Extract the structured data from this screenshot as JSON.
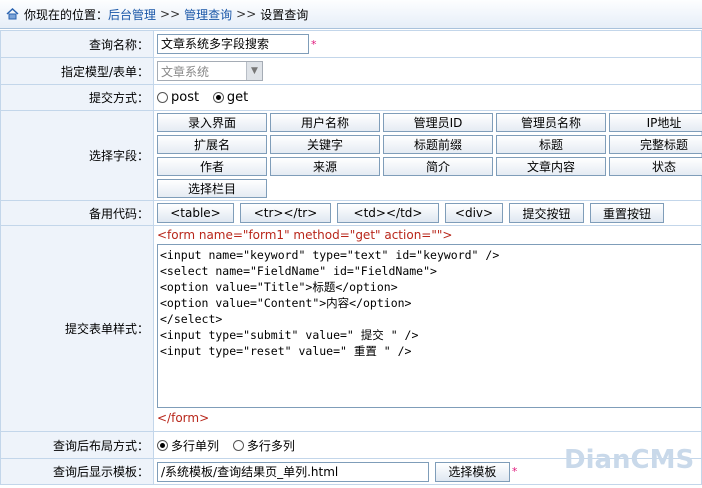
{
  "breadcrumb": {
    "prefix": "你现在的位置：",
    "items": [
      "后台管理",
      "管理查询",
      "设置查询"
    ],
    "separator": ">>"
  },
  "form": {
    "query_name": {
      "label": "查询名称：",
      "value": "文章系统多字段搜索"
    },
    "model": {
      "label": "指定模型/表单：",
      "selected": "文章系统"
    },
    "method": {
      "label": "提交方式：",
      "options": [
        "post",
        "get"
      ],
      "selected": "get"
    },
    "fields": {
      "label": "选择字段：",
      "items": [
        "录入界面",
        "用户名称",
        "管理员ID",
        "管理员名称",
        "IP地址",
        "扩展名",
        "关键字",
        "标题前缀",
        "标题",
        "完整标题",
        "作者",
        "来源",
        "简介",
        "文章内容",
        "状态",
        "选择栏目"
      ]
    },
    "code": {
      "label": "备用代码：",
      "buttons": [
        "<table>",
        "<tr></tr>",
        "<td></td>",
        "<div>",
        "提交按钮",
        "重置按钮"
      ]
    },
    "template": {
      "label": "提交表单样式：",
      "open_tag": "<form name=\"form1\" method=\"get\" action=\"\">",
      "code": "<input name=\"keyword\" type=\"text\" id=\"keyword\" />\n<select name=\"FieldName\" id=\"FieldName\">\n<option value=\"Title\">标题</option>\n<option value=\"Content\">内容</option>\n</select>\n<input type=\"submit\" value=\" 提交 \" />\n<input type=\"reset\" value=\" 重置 \" />",
      "close_tag": "</form>"
    },
    "layout": {
      "label": "查询后布局方式：",
      "options": [
        "多行单列",
        "多行多列"
      ],
      "selected": "多行单列"
    },
    "display_template": {
      "label": "查询后显示模板：",
      "value": "/系统模板/查询结果页_单列.html",
      "button": "选择模板"
    }
  },
  "watermark": "DianCMS",
  "colors": {
    "link": "#1a57a8",
    "required": "#e0197c",
    "form_tag": "#b8261a",
    "label_bg": "#eef3fa",
    "border": "#c3d6ea"
  }
}
